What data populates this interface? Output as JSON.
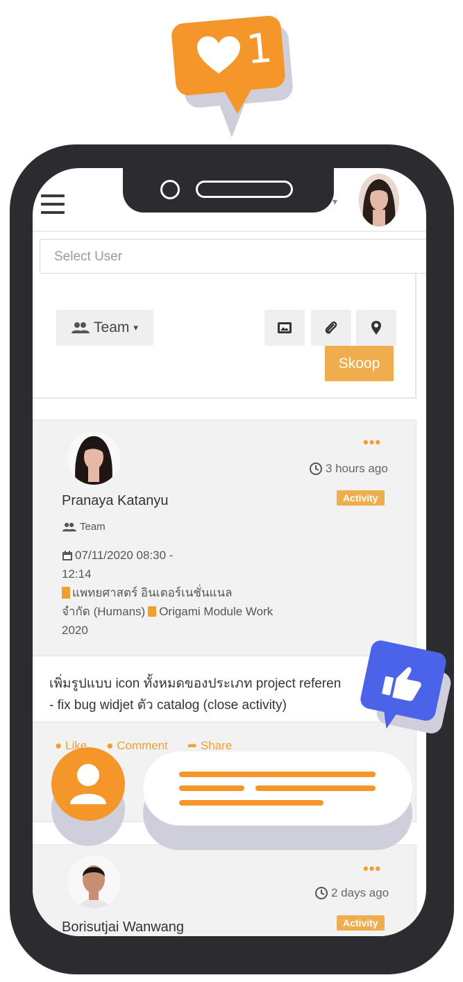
{
  "notification": {
    "count": "1",
    "icon": "heart-icon",
    "color": "#f5962a"
  },
  "colors": {
    "accent": "#f0ad4e",
    "phone_frame": "#2b2b30",
    "like_bubble": "#4b63e8"
  },
  "composer": {
    "select_user_placeholder": "Select User",
    "team_label": "Team",
    "team_caret": "▾",
    "skoop_label": "Skoop"
  },
  "posts": [
    {
      "time": "3 hours ago",
      "badge": "Activity",
      "author": "Pranaya Katanyu",
      "audience": "Team",
      "datetime_line1": "07/11/2020 08:30 -",
      "datetime_line2": "12:14",
      "org_line1": "แพทยศาสตร์ อินเตอร์เนชั่นแนล",
      "org_line2": "จำกัด (Humans)",
      "project": "Origami Module Work",
      "year": "2020",
      "body_line1": "เพิ่มรูปแบบ icon ทั้งหมดของประเภท project referen",
      "body_line2": "- fix bug widjet ตัว catalog (close activity)",
      "actions": {
        "like": "Like",
        "comment": "Comment",
        "share": "Share"
      }
    },
    {
      "time": "2 days ago",
      "badge": "Activity",
      "author": "Borisutjai Wanwang"
    }
  ]
}
